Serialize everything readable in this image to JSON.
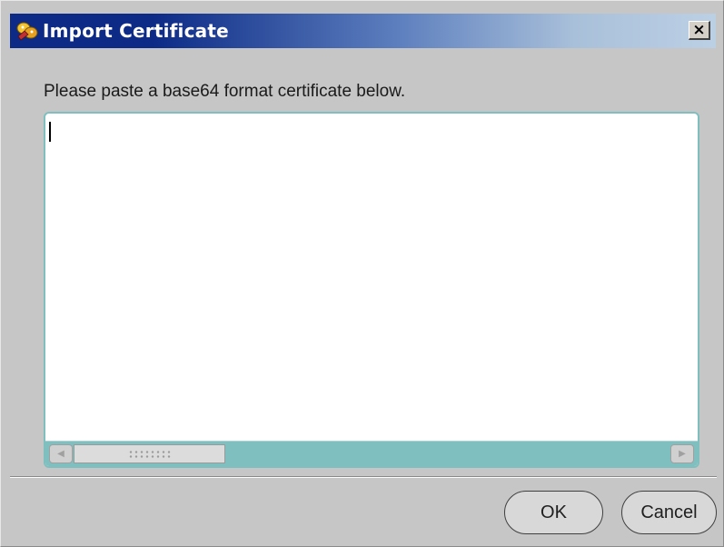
{
  "window": {
    "title": "Import Certificate",
    "close_glyph": "×",
    "icon": "certificate-wizard-icon"
  },
  "content": {
    "prompt": "Please paste a base64 format certificate below.",
    "textarea_value": ""
  },
  "buttons": {
    "ok_label": "OK",
    "cancel_label": "Cancel"
  },
  "scrollbar": {
    "left_arrow": "◀",
    "right_arrow": "▶"
  },
  "colors": {
    "title_start": "#0c2a86",
    "title_end": "#bcd0e4",
    "accent_teal": "#7fbfbf",
    "dialog_bg": "#c6c6c6"
  }
}
